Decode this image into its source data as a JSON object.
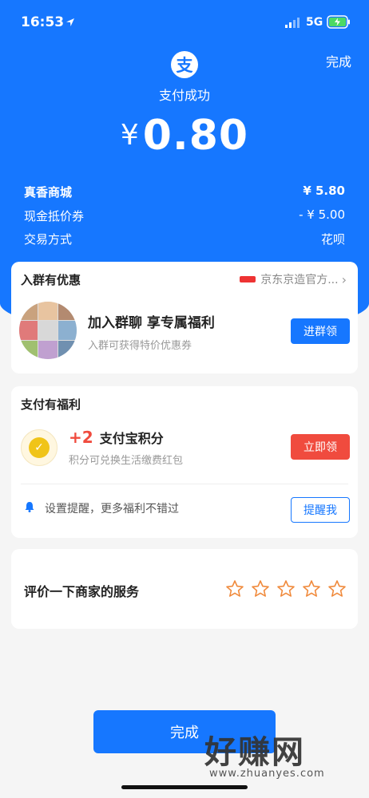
{
  "status_bar": {
    "time": "16:53",
    "network": "5G"
  },
  "header": {
    "done_label": "完成",
    "logo_glyph": "支",
    "title": "支付成功",
    "currency": "¥",
    "amount": "0.80"
  },
  "details": [
    {
      "label": "真香商城",
      "value": "¥ 5.80"
    },
    {
      "label": "现金抵价券",
      "value": "- ¥ 5.00"
    },
    {
      "label": "交易方式",
      "value": "花呗"
    }
  ],
  "group_card": {
    "title": "入群有优惠",
    "merchant": "京东京造官方...",
    "main": "加入群聊  享专属福利",
    "sub": "入群可获得特价优惠券",
    "button": "进群领"
  },
  "benefit_card": {
    "title": "支付有福利",
    "points_plus": "+2",
    "points_title": "支付宝积分",
    "points_sub": "积分可兑换生活缴费红包",
    "claim_button": "立即领",
    "reminder_text": "设置提醒，更多福利不错过",
    "reminder_button": "提醒我"
  },
  "rate_card": {
    "label": "评价一下商家的服务",
    "max_stars": 5,
    "rating": 0
  },
  "footer": {
    "done_label": "完成"
  },
  "watermark": {
    "main": "好赚网",
    "url": "www.zhuanyes.com"
  },
  "colors": {
    "brand_blue": "#1677ff",
    "accent_red": "#f04b3e",
    "star_orange": "#f08a3c"
  }
}
